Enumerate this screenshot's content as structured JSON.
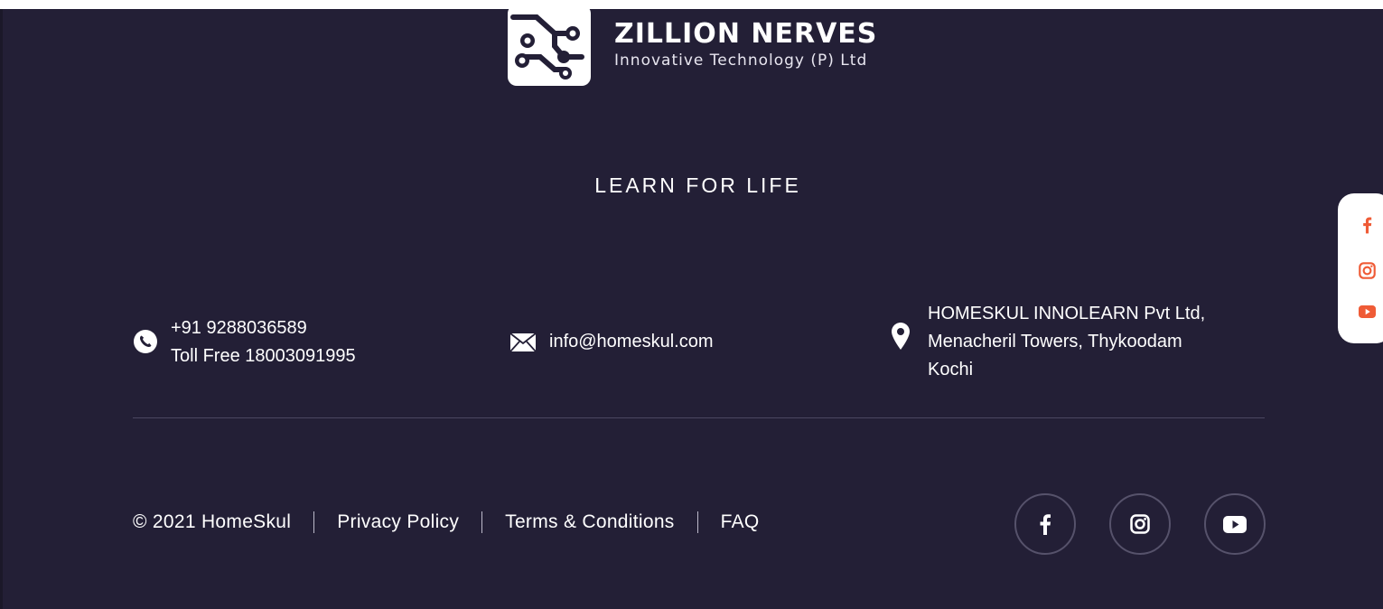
{
  "brand": {
    "name": "ZILLION NERVES",
    "subtitle": "Innovative Technology (P) Ltd"
  },
  "tagline": "LEARN FOR LIFE",
  "contacts": {
    "phone": {
      "icon": "phone-icon",
      "lines": [
        "+91 9288036589",
        "Toll Free 18003091995"
      ]
    },
    "email": {
      "icon": "mail-icon",
      "value": "info@homeskul.com"
    },
    "address": {
      "icon": "location-pin-icon",
      "lines": [
        "HOMESKUL INNOLEARN Pvt Ltd,",
        "Menacheril Towers, Thykoodam",
        "Kochi"
      ]
    }
  },
  "footer": {
    "copyright": "© 2021 HomeSkul",
    "links": [
      "Privacy Policy",
      "Terms & Conditions",
      "FAQ"
    ]
  },
  "social": [
    "facebook-icon",
    "instagram-icon",
    "youtube-icon"
  ],
  "floating_social": [
    "facebook-icon",
    "instagram-icon",
    "youtube-icon"
  ],
  "colors": {
    "background": "#231f36",
    "text": "#ffffff",
    "social_border": "#56526b",
    "floating_accent": "#ef5b36"
  }
}
